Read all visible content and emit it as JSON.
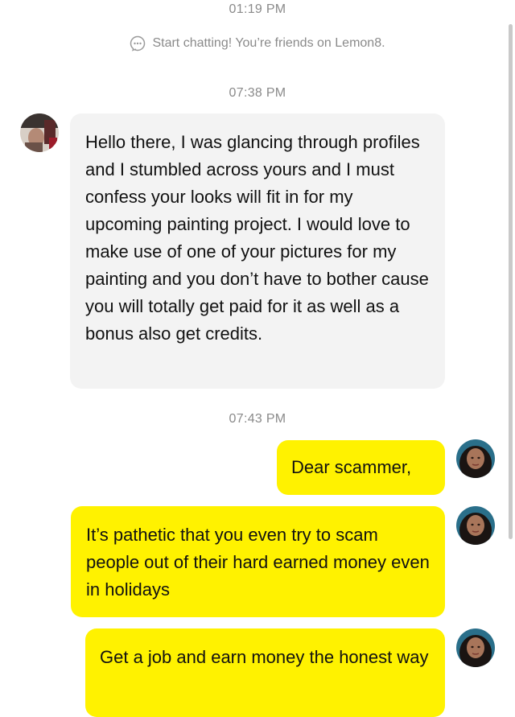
{
  "timestamps": [
    "01:19 PM",
    "07:38 PM",
    "07:43 PM"
  ],
  "system_message": "Start chatting! You’re friends on Lemon8.",
  "messages": [
    {
      "sender": "other",
      "text": "Hello there, I was glancing through profiles and I stumbled across yours and I must confess your looks will fit in for my upcoming painting project. I would love to make use of one of your pictures for my painting and you don’t have to bother cause you will totally get paid for it as well as a bonus also get credits."
    },
    {
      "sender": "me",
      "text": "Dear scammer,"
    },
    {
      "sender": "me",
      "text": "It’s pathetic that you even try to scam people out of their hard earned money even in holidays"
    },
    {
      "sender": "me",
      "text": "Get a job and earn money the honest way"
    }
  ],
  "colors": {
    "incoming_bubble": "#f3f3f3",
    "outgoing_bubble": "#fff200",
    "timestamp_text": "#8a8a8a"
  }
}
